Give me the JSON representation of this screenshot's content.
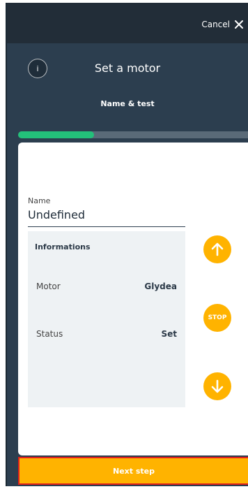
{
  "topbar": {
    "cancel_label": "Cancel",
    "close_icon": "close-icon"
  },
  "header": {
    "info_label": "i",
    "title": "Set a motor",
    "step_title": "Name & test"
  },
  "progress": {
    "fraction": 0.33
  },
  "form": {
    "name_label": "Name",
    "name_value": "Undefined"
  },
  "info_panel": {
    "title": "Informations",
    "rows": [
      {
        "label": "Motor",
        "value": "Glydea"
      },
      {
        "label": "Status",
        "value": "Set"
      }
    ]
  },
  "controls": {
    "up_icon": "arrow-up-icon",
    "stop_label": "STOP",
    "down_icon": "arrow-down-icon"
  },
  "footer": {
    "next_label": "Next step"
  },
  "colors": {
    "header_bg": "#2c3e4f",
    "topbar_bg": "#222d38",
    "accent": "#ffb300",
    "progress": "#23c07a",
    "highlight": "#e0201c"
  }
}
